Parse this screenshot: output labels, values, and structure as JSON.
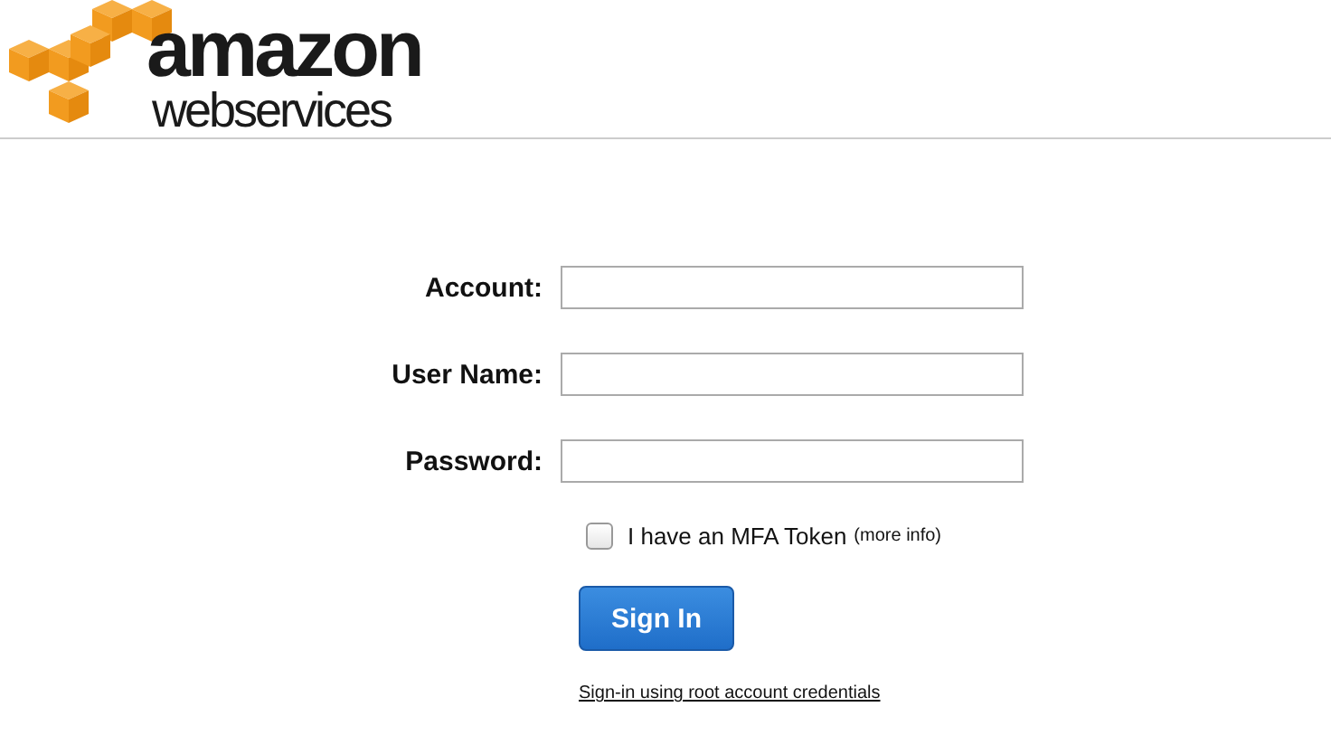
{
  "logo": {
    "line_1": "amazon",
    "line_2": "webservices"
  },
  "fields": [
    {
      "label": "Account:"
    },
    {
      "label": "User Name:"
    },
    {
      "label": "Password:"
    }
  ],
  "mfa": {
    "label": "I have an MFA Token",
    "link": "(more info)",
    "checked": false
  },
  "sign_in_button": "Sign In",
  "root_link": "Sign-in using root account credentials"
}
